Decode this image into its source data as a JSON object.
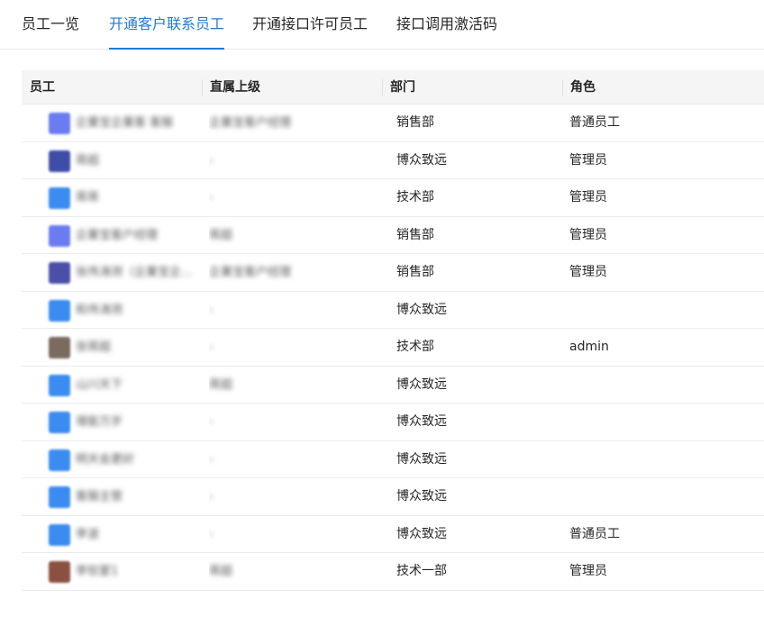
{
  "tabs": [
    {
      "label": "员工一览",
      "active": false
    },
    {
      "label": "开通客户联系员工",
      "active": true
    },
    {
      "label": "开通接口许可员工",
      "active": false
    },
    {
      "label": "接口调用激活码",
      "active": false
    }
  ],
  "colors": {
    "accent": "#1f7ad8"
  },
  "table": {
    "headers": [
      "员工",
      "直属上级",
      "部门",
      "角色"
    ],
    "rows": [
      {
        "employee": "企業宝企業客 客服",
        "avatar_color": "#6a7cf0",
        "supervisor": "企業宝客户经理",
        "department": "销售部",
        "role": "普通员工"
      },
      {
        "employee": "蒋超",
        "avatar_color": "#3e4ea8",
        "supervisor": "-",
        "department": "博众致远",
        "role": "管理员"
      },
      {
        "employee": "蒋蒋",
        "avatar_color": "#3a8cf0",
        "supervisor": "-",
        "department": "技术部",
        "role": "管理员"
      },
      {
        "employee": "企業宝客户经理",
        "avatar_color": "#6a7cf0",
        "supervisor": "蒋超",
        "department": "销售部",
        "role": "管理员"
      },
      {
        "employee": "张伟涛测（企業宝企...",
        "avatar_color": "#4b4fa8",
        "supervisor": "企業宝客户经理",
        "department": "销售部",
        "role": "管理员"
      },
      {
        "employee": "和伟涛测",
        "avatar_color": "#3a8cf0",
        "supervisor": "-",
        "department": "博众致远",
        "role": ""
      },
      {
        "employee": "张蒋超",
        "avatar_color": "#7a6a60",
        "supervisor": "-",
        "department": "技术部",
        "role": "admin"
      },
      {
        "employee": "山川天下",
        "avatar_color": "#3a8cf0",
        "supervisor": "蒋超",
        "department": "博众致远",
        "role": ""
      },
      {
        "employee": "增能万岁",
        "avatar_color": "#3a8cf0",
        "supervisor": "-",
        "department": "博众致远",
        "role": ""
      },
      {
        "employee": "明天会更好",
        "avatar_color": "#3a8cf0",
        "supervisor": "-",
        "department": "博众致远",
        "role": ""
      },
      {
        "employee": "客服主管",
        "avatar_color": "#3a8cf0",
        "supervisor": "-",
        "department": "博众致远",
        "role": ""
      },
      {
        "employee": "李波",
        "avatar_color": "#3a8cf0",
        "supervisor": "-",
        "department": "博众致远",
        "role": "普通员工"
      },
      {
        "employee": "李钦蒙1",
        "avatar_color": "#8a5040",
        "supervisor": "蒋超",
        "department": "技术一部",
        "role": "管理员"
      }
    ]
  }
}
